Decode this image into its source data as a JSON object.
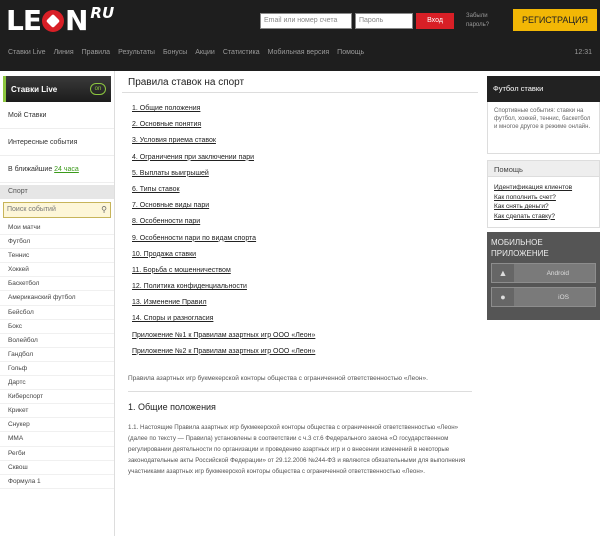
{
  "header": {
    "logo_text_1": "LE",
    "logo_text_2": "N",
    "logo_ru": "RU",
    "login_placeholder": "Email или номер счета",
    "password_placeholder": "Пароль",
    "login_button": "Вход",
    "small_links": "Забыли пароль?",
    "register_button": "РЕГИСТРАЦИЯ",
    "nav": [
      "Ставки Live",
      "Линия",
      "Правила",
      "Результаты",
      "Бонусы",
      "Акции",
      "Статистика",
      "Мобильная версия",
      "Помощь"
    ],
    "nav_right": "12:31"
  },
  "sidebar": {
    "live_title": "Ставки Live",
    "live_icon": "live-icon",
    "links": [
      {
        "text": "Мой Ставки",
        "green": ""
      },
      {
        "text": "Интересные события",
        "green": ""
      },
      {
        "text": "В ближайшие ",
        "green": "24 часа"
      }
    ],
    "sport_head": "Спорт",
    "search_placeholder": "Поиск событий",
    "sports": [
      "Мои матчи",
      "Футбол",
      "Теннис",
      "Хоккей",
      "Баскетбол",
      "Американский футбол",
      "Бейсбол",
      "Бокс",
      "Волейбол",
      "Гандбол",
      "Гольф",
      "Дартс",
      "Киберспорт",
      "Крикет",
      "Снукер",
      "ММА",
      "Регби",
      "Сквош",
      "Формула 1"
    ]
  },
  "main": {
    "title": "Правила ставок на спорт",
    "toc": [
      "1. Общие положения",
      "2. Основные понятия",
      "3. Условия приема ставок",
      "4. Ограничения при заключении пари",
      "5. Выплаты выигрышей",
      "6. Типы ставок",
      "7. Основные виды пари",
      "8. Особенности пари",
      "9. Особенности пари по видам спорта",
      "10. Продажа ставки",
      "11. Борьба с мошенничеством",
      "12. Политика конфиденциальности",
      "13. Изменение Правил",
      "14. Споры и разногласия",
      "Приложение №1 к Правилам азартных игр ООО «Леон»",
      "Приложение №2 к Правилам азартных игр ООО «Леон»"
    ],
    "intro": "Правила азартных игр букмекерской конторы общества с ограниченной ответственностью «Леон».",
    "section_title": "1. Общие положения",
    "paragraph": "1.1. Настоящие Правила азартных игр букмекерской конторы общества с ограниченной ответственностью «Леон» (далее по тексту — Правила) установлены в соответствии с ч.3 ст.6 Федерального закона «О государственном регулировании деятельности по организации и проведению азартных игр и о внесении изменений в некоторые законодательные акты Российской Федерации» от 29.12.2006 №244-ФЗ и являются обязательными для выполнения участниками азартных игр букмекерской конторы общества с ограниченной ответственностью «Леон»."
  },
  "rightbar": {
    "head": "Футбол ставки",
    "text": "Спортивные события: ставки на футбол, хоккей, теннис, баскетбол и многое другое в режиме онлайн.",
    "help_head": "Помощь",
    "help_links": [
      "Идентификация клиентов",
      "Как пополнить счет?",
      "Как снять деньги?",
      "Как сделать ставку?"
    ],
    "app_title_1": "МОБИЛЬНОЕ",
    "app_title_2": "ПРИЛОЖЕНИЕ",
    "android_label": "Android",
    "android_icon": "android-icon",
    "ios_label": "iOS",
    "ios_icon": "apple-icon"
  },
  "colors": {
    "header_bg": "#1e1e1e",
    "accent_red": "#d81f26",
    "register_yellow": "#f2b705",
    "live_green": "#8cc63f"
  }
}
